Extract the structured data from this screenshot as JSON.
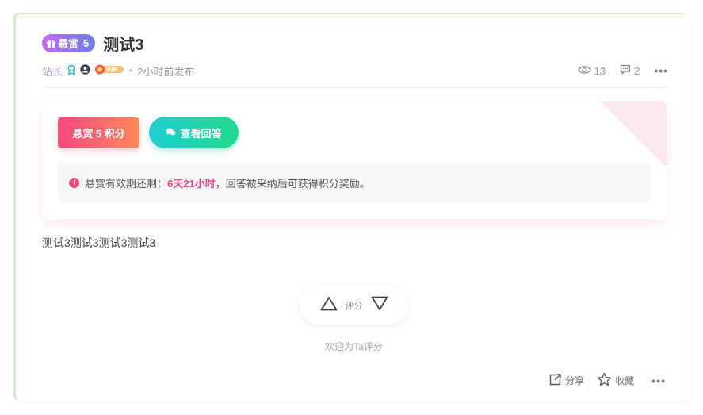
{
  "post": {
    "bounty_badge": {
      "label": "悬赏",
      "amount": "5"
    },
    "title": "测试3",
    "author": "站长",
    "vip_badge": "VIP",
    "published": "2小时前发布",
    "views": "13",
    "comments": "2"
  },
  "bounty_box": {
    "reward_button": "悬赏 5 积分",
    "view_answers_button": "查看回答",
    "notice_prefix": "悬赏有效期还剩：",
    "notice_remaining": "6天21小时",
    "notice_suffix": "，回答被采纳后可获得积分奖励。"
  },
  "content": "测试3测试3测试3测试3",
  "rating": {
    "label": "评分",
    "caption": "欢迎为Ta评分"
  },
  "footer": {
    "share": "分享",
    "favorite": "收藏"
  },
  "colors": {
    "accent_pink": "#f0457a",
    "accent_teal": "#1fcfd1",
    "badge_purple": "#c06cf5",
    "author_purple": "#b39be8"
  }
}
